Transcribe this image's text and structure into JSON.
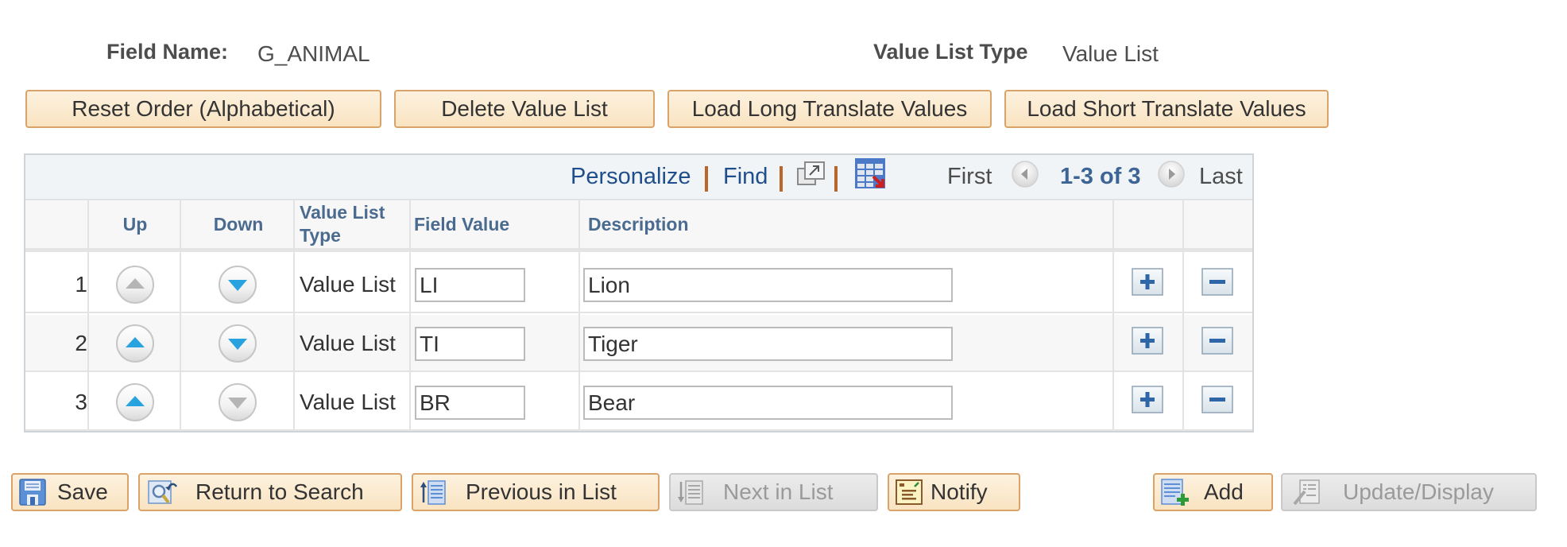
{
  "header": {
    "field_name_label": "Field Name:",
    "field_name_value": "G_ANIMAL",
    "value_list_type_label": "Value List Type",
    "value_list_type_value": "Value List"
  },
  "actions": {
    "reset_order": "Reset Order (Alphabetical)",
    "delete_value_list": "Delete Value List",
    "load_long": "Load Long Translate Values",
    "load_short": "Load Short Translate Values"
  },
  "grid": {
    "toolbar": {
      "personalize": "Personalize",
      "find": "Find",
      "new_window_icon": "new-window-icon",
      "download_icon": "download-to-excel-icon",
      "first": "First",
      "range": "1-3 of 3",
      "last": "Last"
    },
    "columns": {
      "up": "Up",
      "down": "Down",
      "value_list_type": "Value List Type",
      "field_value": "Field Value",
      "description": "Description"
    },
    "rows": [
      {
        "num": "1",
        "type": "Value List",
        "field_value": "LI",
        "description": "Lion",
        "up_enabled": false,
        "down_enabled": true
      },
      {
        "num": "2",
        "type": "Value List",
        "field_value": "TI",
        "description": "Tiger",
        "up_enabled": true,
        "down_enabled": true
      },
      {
        "num": "3",
        "type": "Value List",
        "field_value": "BR",
        "description": "Bear",
        "up_enabled": true,
        "down_enabled": false
      }
    ]
  },
  "footer": {
    "save": "Save",
    "return_to_search": "Return to Search",
    "previous_in_list": "Previous in List",
    "next_in_list": "Next in List",
    "notify": "Notify",
    "add": "Add",
    "update_display": "Update/Display"
  },
  "colors": {
    "link": "#1f4e8c",
    "header_text": "#4a6b8f",
    "button_border": "#d9a36a",
    "separator": "#b8662a",
    "arrow_enabled": "#29a3e0"
  }
}
